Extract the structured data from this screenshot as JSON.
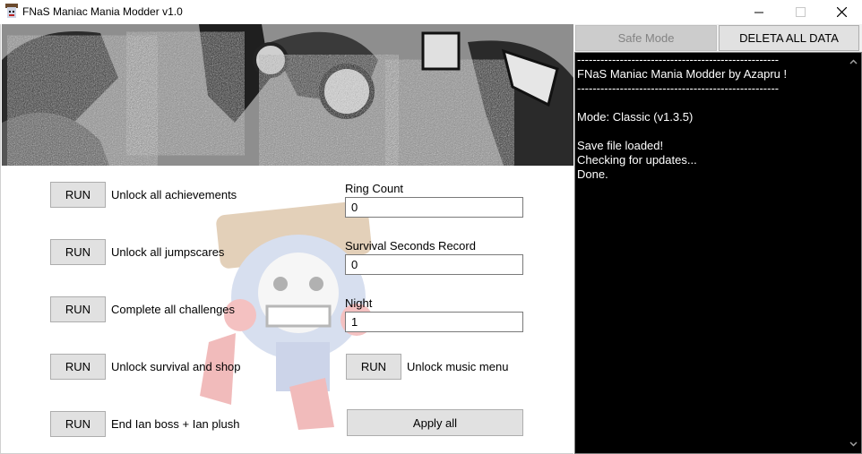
{
  "window": {
    "title": "FNaS Maniac Mania Modder v1.0",
    "min_glyph": "—",
    "max_glyph": "☐",
    "close_glyph": "✕"
  },
  "actions": [
    {
      "button": "RUN",
      "label": "Unlock all achievements"
    },
    {
      "button": "RUN",
      "label": "Unlock all jumpscares"
    },
    {
      "button": "RUN",
      "label": "Complete all challenges"
    },
    {
      "button": "RUN",
      "label": "Unlock survival and shop"
    },
    {
      "button": "RUN",
      "label": "End Ian boss + Ian plush"
    }
  ],
  "fields": [
    {
      "label": "Ring Count",
      "value": "0"
    },
    {
      "label": "Survival Seconds Record",
      "value": "0"
    },
    {
      "label": "Night",
      "value": "1"
    }
  ],
  "music": {
    "button": "RUN",
    "label": "Unlock music menu"
  },
  "apply_all": "Apply all",
  "safe_mode": "Safe Mode",
  "delete_all": "DELETA ALL DATA",
  "console_lines": [
    "----------------------------------------------------",
    "FNaS Maniac Mania Modder by Azapru !",
    "----------------------------------------------------",
    "",
    "Mode: Classic (v1.3.5)",
    "",
    "Save file loaded!",
    "Checking for updates...",
    "Done."
  ],
  "colors": {
    "console_bg": "#000000",
    "console_fg": "#ffffff",
    "button_bg": "#e1e1e1",
    "disabled_button_bg": "#cccccc"
  }
}
